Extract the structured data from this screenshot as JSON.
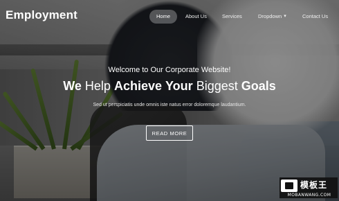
{
  "brand": {
    "name": "Employment"
  },
  "nav": {
    "items": [
      {
        "label": "Home",
        "active": true
      },
      {
        "label": "About Us"
      },
      {
        "label": "Services"
      },
      {
        "label": "Dropdown",
        "has_caret": true
      },
      {
        "label": "Contact Us"
      }
    ],
    "caret_icon": "chevron-down-icon"
  },
  "hero": {
    "welcome": "Welcome to Our Corporate Website!",
    "headline_parts": [
      "We",
      "Help",
      "Achieve",
      "Your",
      "Biggest",
      "Goals"
    ],
    "subtext": "Sed ut perspiciatis unde omnis iste natus error doloremque laudantium.",
    "button_label": "READ MORE"
  },
  "watermark": {
    "cn_text": "模板王",
    "url": "MOBANWANG.COM"
  },
  "colors": {
    "text": "#ffffff",
    "overlay": "#000000",
    "watermark_bg": "#111111"
  }
}
